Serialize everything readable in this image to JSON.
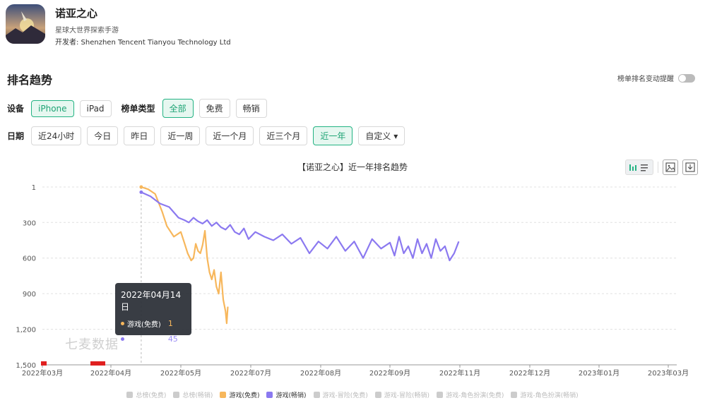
{
  "app": {
    "name": "诺亚之心",
    "subtitle": "星球大世界探索手游",
    "developer": "开发者: Shenzhen Tencent Tianyou Technology Ltd"
  },
  "section_title": "排名趋势",
  "alert_label": "榜单排名变动提醒",
  "device": {
    "label": "设备",
    "options": [
      "iPhone",
      "iPad"
    ],
    "selected": "iPhone"
  },
  "list_type": {
    "label": "榜单类型",
    "options": [
      "全部",
      "免费",
      "畅销"
    ],
    "selected": "全部"
  },
  "date": {
    "label": "日期",
    "options": [
      "近24小时",
      "今日",
      "昨日",
      "近一周",
      "近一个月",
      "近三个月",
      "近一年",
      "自定义 ▾"
    ],
    "selected": "近一年"
  },
  "tooltip": {
    "date": "2022年04月14日",
    "rows": [
      {
        "name": "游戏(免费)",
        "value": "1"
      },
      {
        "name": "游戏(畅销)",
        "value": "45"
      }
    ]
  },
  "watermark": "七麦数据",
  "colors": {
    "accent": "#23b383",
    "free": "#f7b75c",
    "grossing": "#8b79f0"
  },
  "chart_data": {
    "type": "line",
    "title": "【诺亚之心】近一年排名趋势",
    "y_reversed": true,
    "ylim": [
      1,
      1500
    ],
    "y_ticks": [
      1,
      300,
      600,
      900,
      1200,
      1500
    ],
    "y_tick_labels": [
      "1",
      "300",
      "600",
      "900",
      "1,200",
      "1,500"
    ],
    "x_ticks": [
      "2022年03月",
      "2022年04月",
      "2022年05月",
      "2022年07月",
      "2022年08月",
      "2022年09月",
      "2022年11月",
      "2022年12月",
      "2023年01月",
      "2023年03月"
    ],
    "series": [
      {
        "name": "游戏(免费)",
        "color": "#f7b75c",
        "x": [
          "2022-04-14",
          "2022-04-17",
          "2022-04-20",
          "2022-04-23",
          "2022-04-25",
          "2022-04-28",
          "2022-05-01",
          "2022-05-04",
          "2022-05-07",
          "2022-05-10",
          "2022-05-12",
          "2022-05-14",
          "2022-05-16",
          "2022-05-18",
          "2022-05-20",
          "2022-05-22",
          "2022-05-24",
          "2022-05-26",
          "2022-05-28",
          "2022-05-30",
          "2022-06-01",
          "2022-06-03",
          "2022-06-05",
          "2022-06-07",
          "2022-06-09",
          "2022-06-10",
          "2022-06-11"
        ],
        "y": [
          1,
          20,
          60,
          210,
          330,
          420,
          380,
          470,
          560,
          620,
          600,
          480,
          540,
          560,
          490,
          370,
          600,
          720,
          780,
          700,
          840,
          900,
          720,
          950,
          1050,
          1150,
          1010
        ]
      },
      {
        "name": "游戏(畅销)",
        "color": "#8b79f0",
        "x": [
          "2022-04-14",
          "2022-04-18",
          "2022-04-22",
          "2022-04-26",
          "2022-04-30",
          "2022-05-04",
          "2022-05-08",
          "2022-05-12",
          "2022-05-16",
          "2022-05-20",
          "2022-05-24",
          "2022-05-28",
          "2022-06-01",
          "2022-06-05",
          "2022-06-09",
          "2022-06-13",
          "2022-06-17",
          "2022-06-21",
          "2022-06-25",
          "2022-06-29",
          "2022-07-03",
          "2022-07-07",
          "2022-07-11",
          "2022-07-15",
          "2022-07-19",
          "2022-07-23",
          "2022-07-27",
          "2022-07-31",
          "2022-08-04",
          "2022-08-08",
          "2022-08-12",
          "2022-08-16",
          "2022-08-20",
          "2022-08-24",
          "2022-08-28",
          "2022-09-01",
          "2022-09-05",
          "2022-09-09",
          "2022-09-13",
          "2022-09-17",
          "2022-09-21",
          "2022-09-25",
          "2022-09-29",
          "2022-10-03",
          "2022-10-07",
          "2022-10-11",
          "2022-10-15",
          "2022-10-19",
          "2022-10-23",
          "2022-10-27",
          "2022-10-31"
        ],
        "y": [
          45,
          80,
          140,
          170,
          260,
          280,
          300,
          260,
          290,
          310,
          280,
          330,
          300,
          340,
          360,
          320,
          380,
          400,
          350,
          440,
          380,
          420,
          450,
          400,
          480,
          430,
          560,
          460,
          520,
          420,
          540,
          460,
          600,
          440,
          520,
          470,
          580,
          420,
          560,
          500,
          600,
          440,
          560,
          480,
          600,
          440,
          540,
          500,
          620,
          560,
          460
        ]
      }
    ],
    "legend": [
      {
        "name": "总榜(免费)",
        "active": false
      },
      {
        "name": "总榜(畅销)",
        "active": false
      },
      {
        "name": "游戏(免费)",
        "active": true
      },
      {
        "name": "游戏(畅销)",
        "active": true
      },
      {
        "name": "游戏-冒险(免费)",
        "active": false
      },
      {
        "name": "游戏-冒险(畅销)",
        "active": false
      },
      {
        "name": "游戏-角色扮演(免费)",
        "active": false
      },
      {
        "name": "游戏-角色扮演(畅销)",
        "active": false
      }
    ],
    "legend_position": "bottom",
    "grid": true
  }
}
